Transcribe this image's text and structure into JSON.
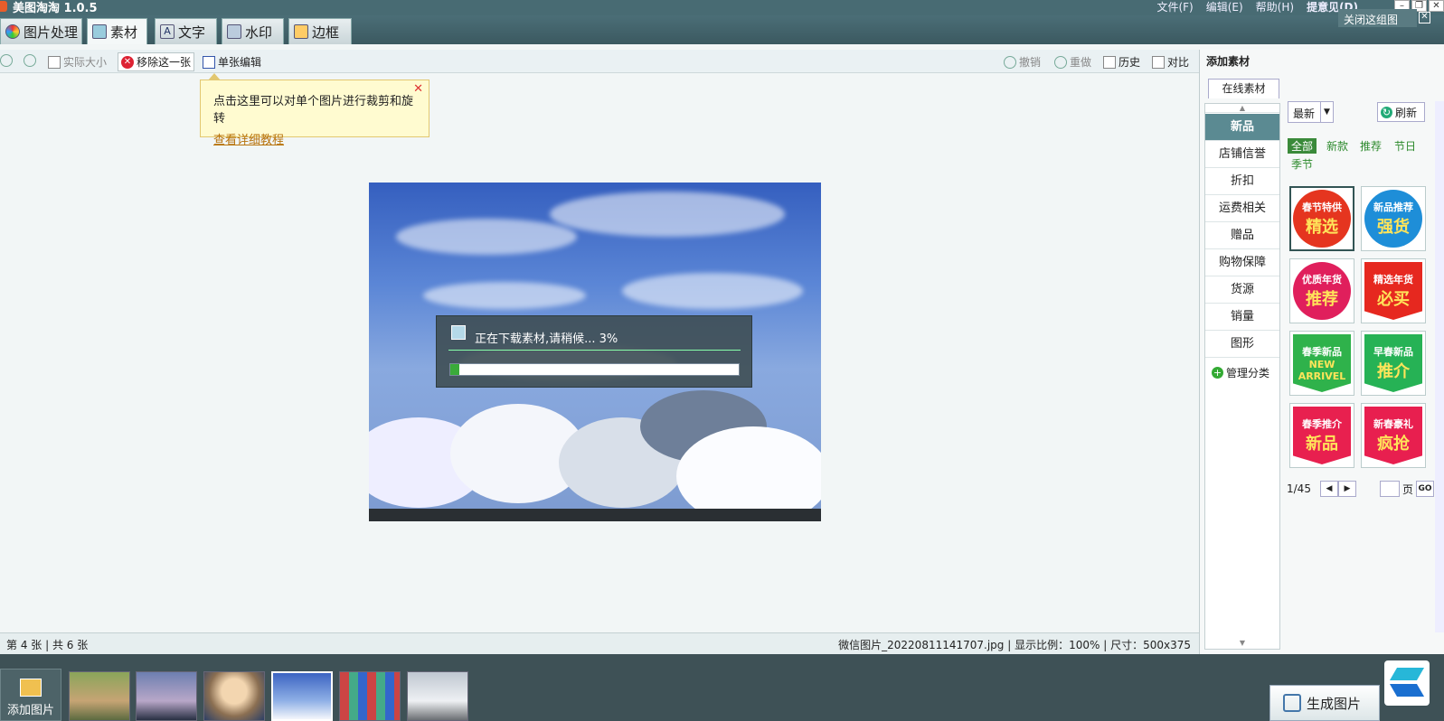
{
  "app": {
    "title": "美图淘淘 1.0.5"
  },
  "menu": {
    "file": "文件(F)",
    "edit": "编辑(E)",
    "help": "帮助(H)",
    "user": "提意见(D)"
  },
  "window_controls": {
    "minimize": "–",
    "restore": "❐",
    "close": "✕"
  },
  "tabs": [
    {
      "label": "图片处理"
    },
    {
      "label": "素材"
    },
    {
      "label": "文字"
    },
    {
      "label": "水印"
    },
    {
      "label": "边框"
    }
  ],
  "active_tab": "素材",
  "close_group": {
    "label": "关闭这组图",
    "x": "✕"
  },
  "toolbar": {
    "actual_size": "实际大小",
    "remove_this": "移除这一张",
    "single_edit": "单张编辑",
    "undo": "撤销",
    "redo": "重做",
    "history": "历史",
    "compare": "对比"
  },
  "tip": {
    "text": "点击这里可以对单个图片进行裁剪和旋转",
    "link": "查看详细教程",
    "close": "✕"
  },
  "download_dialog": {
    "text": "正在下载素材,请稍候... 3%",
    "progress": 3
  },
  "status": {
    "current": "第 4 张",
    "total": "共 6 张",
    "filename": "微信图片_20220811141707.jpg",
    "zoom": "显示比例：100%",
    "size": "尺寸：500x375"
  },
  "filmstrip": {
    "add_label": "添加图片",
    "count": 6,
    "active_index": 3
  },
  "right_panel": {
    "title": "添加素材",
    "tab": "在线素材",
    "categories": [
      "新品",
      "店铺信誉",
      "折扣",
      "运费相关",
      "赠品",
      "购物保障",
      "货源",
      "销量",
      "图形"
    ],
    "manage": "管理分类",
    "sort": "最新",
    "refresh": "刷新",
    "filters": [
      "全部",
      "新款",
      "推荐",
      "节日",
      "季节"
    ],
    "stickers": [
      {
        "top": "春节特供",
        "bottom": "精选",
        "bg": "#e5351f",
        "shape": "circle"
      },
      {
        "top": "新品推荐",
        "bottom": "强货",
        "bg": "#1e8ed8",
        "shape": "circle"
      },
      {
        "top": "优质年货",
        "bottom": "推荐",
        "bg": "#e01f5c",
        "shape": "circle"
      },
      {
        "top": "精选年货",
        "bottom": "必买",
        "bg": "#e6281f",
        "shape": "flag"
      },
      {
        "top": "春季新品",
        "bottom": "NEW ARRIVEL",
        "bg": "#2fb24b",
        "shape": "flag"
      },
      {
        "top": "早春新品",
        "bottom": "推介",
        "bg": "#26b255",
        "shape": "flag"
      },
      {
        "top": "春季推介",
        "bottom": "新品",
        "bg": "#e8204f",
        "shape": "flag"
      },
      {
        "top": "新春豪礼",
        "bottom": "疯抢",
        "bg": "#e81f4f",
        "shape": "flag"
      }
    ],
    "pager": {
      "page": "1/45",
      "page_unit": "页",
      "go": "GO"
    }
  },
  "generate": {
    "label": "生成图片"
  }
}
